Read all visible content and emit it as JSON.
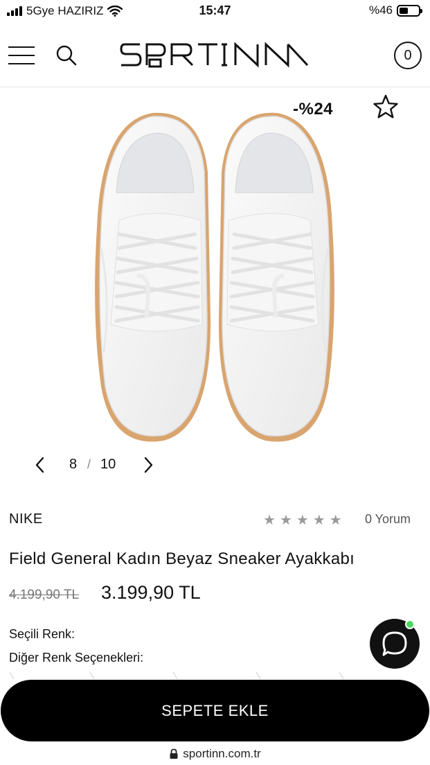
{
  "status_bar": {
    "carrier": "5Gye HAZIRIZ",
    "time": "15:47",
    "battery": "%46",
    "battery_level": 0.46
  },
  "header": {
    "logo_text": "SPORTINN",
    "cart_count": "0"
  },
  "product": {
    "discount_badge": "-%24",
    "gallery": {
      "current": "8",
      "separator": "/",
      "total": "10"
    },
    "brand": "NIKE",
    "rating": 0,
    "reviews_label": "0 Yorum",
    "title": "Field General Kadın Beyaz Sneaker Ayakkabı",
    "old_price": "4.199,90 TL",
    "price": "3.199,90 TL",
    "selected_color_label": "Seçili Renk:",
    "other_colors_label": "Diğer Renk Seçenekleri:"
  },
  "actions": {
    "add_to_cart": "SEPETE EKLE"
  },
  "browser": {
    "url": "sportinn.com.tr"
  },
  "colors": {
    "primary": "#000000",
    "star_inactive": "#9a9a9a",
    "chat_online": "#4cd964",
    "gum_sole": "#d9a46e"
  }
}
